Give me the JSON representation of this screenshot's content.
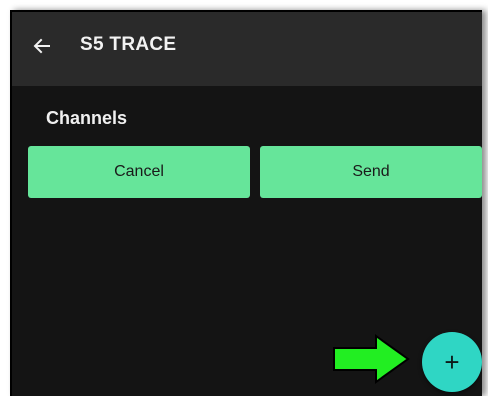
{
  "appbar": {
    "title": "S5 TRACE",
    "back_icon": "arrow-left-icon"
  },
  "section": {
    "title": "Channels"
  },
  "actions": {
    "cancel_label": "Cancel",
    "send_label": "Send"
  },
  "fab": {
    "icon": "plus-icon",
    "glyph": "+"
  },
  "annotation": {
    "icon": "green-arrow-icon"
  },
  "colors": {
    "background": "#141414",
    "appbar": "#2a2a2a",
    "button": "#66e59a",
    "fab": "#2fd6c4",
    "annotation_arrow": "#22ee22"
  }
}
